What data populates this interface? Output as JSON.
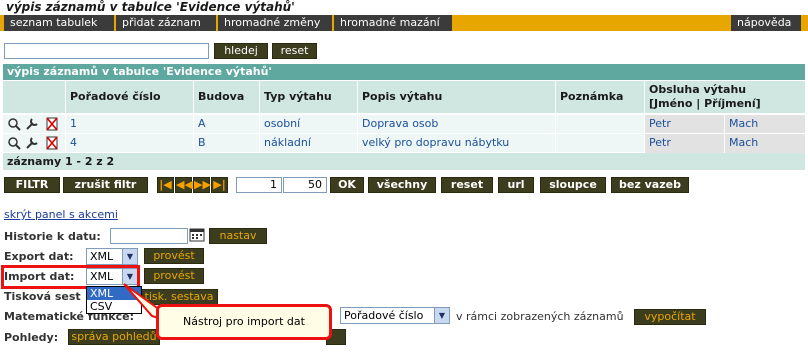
{
  "title": "výpis záznamů v tabulce 'Evidence výtahů'",
  "menu": {
    "items": [
      "seznam tabulek",
      "přidat záznam",
      "hromadné změny",
      "hromadné mazání"
    ],
    "help": "nápověda"
  },
  "search": {
    "value": "",
    "search_label": "hledej",
    "reset_label": "reset"
  },
  "table": {
    "caption": "výpis záznamů v tabulce 'Evidence výtahů'",
    "columns": [
      "Pořadové číslo",
      "Budova",
      "Typ výtahu",
      "Popis výtahu",
      "Poznámka"
    ],
    "obsluha_header": "Obsluha výtahu",
    "obsluha_sub": "[Jméno | Příjmení]",
    "rows": [
      {
        "cislo": "1",
        "budova": "A",
        "typ": "osobní",
        "popis": "Doprava osob",
        "poznamka": "",
        "jmeno": "Petr",
        "prijmeni": "Mach"
      },
      {
        "cislo": "4",
        "budova": "B",
        "typ": "nákladní",
        "popis": "velký pro dopravu nábytku",
        "poznamka": "",
        "jmeno": "Petr",
        "prijmeni": "Mach"
      }
    ],
    "footer": "záznamy 1 - 2 z 2"
  },
  "toolbar": {
    "filtr": "FILTR",
    "zrusit_filtr": "zrušit filtr",
    "from_value": "1",
    "count_value": "50",
    "ok": "OK",
    "vsechny": "všechny",
    "reset": "reset",
    "url": "url",
    "sloupce": "sloupce",
    "bez_vazeb": "bez vazeb"
  },
  "panel": {
    "hide_link": "skrýt panel s akcemi",
    "historie_label": "Historie k datu:",
    "nastav": "nastav",
    "export_label": "Export dat:",
    "export_value": "XML",
    "provest": "provést",
    "import_label": "Import dat:",
    "import_value": "XML",
    "import_options": [
      "XML",
      "CSV"
    ],
    "tiskova_label": "Tisková sest",
    "tiskova_button": "tisk. sestava",
    "matematicke_label": "Matematické funkce:",
    "poradove_value": "Pořadové číslo",
    "v_ramci": "v rámci zobrazených záznamů",
    "vypocitat": "vypočítat",
    "pohledy_label": "Pohledy:",
    "sprava_pohledu": "správa pohledů"
  },
  "tooltip": "Nástroj pro import dat",
  "colors": {
    "menubar": "#e8a700",
    "table_header": "#5fa8a0",
    "highlight": "#e11111"
  }
}
